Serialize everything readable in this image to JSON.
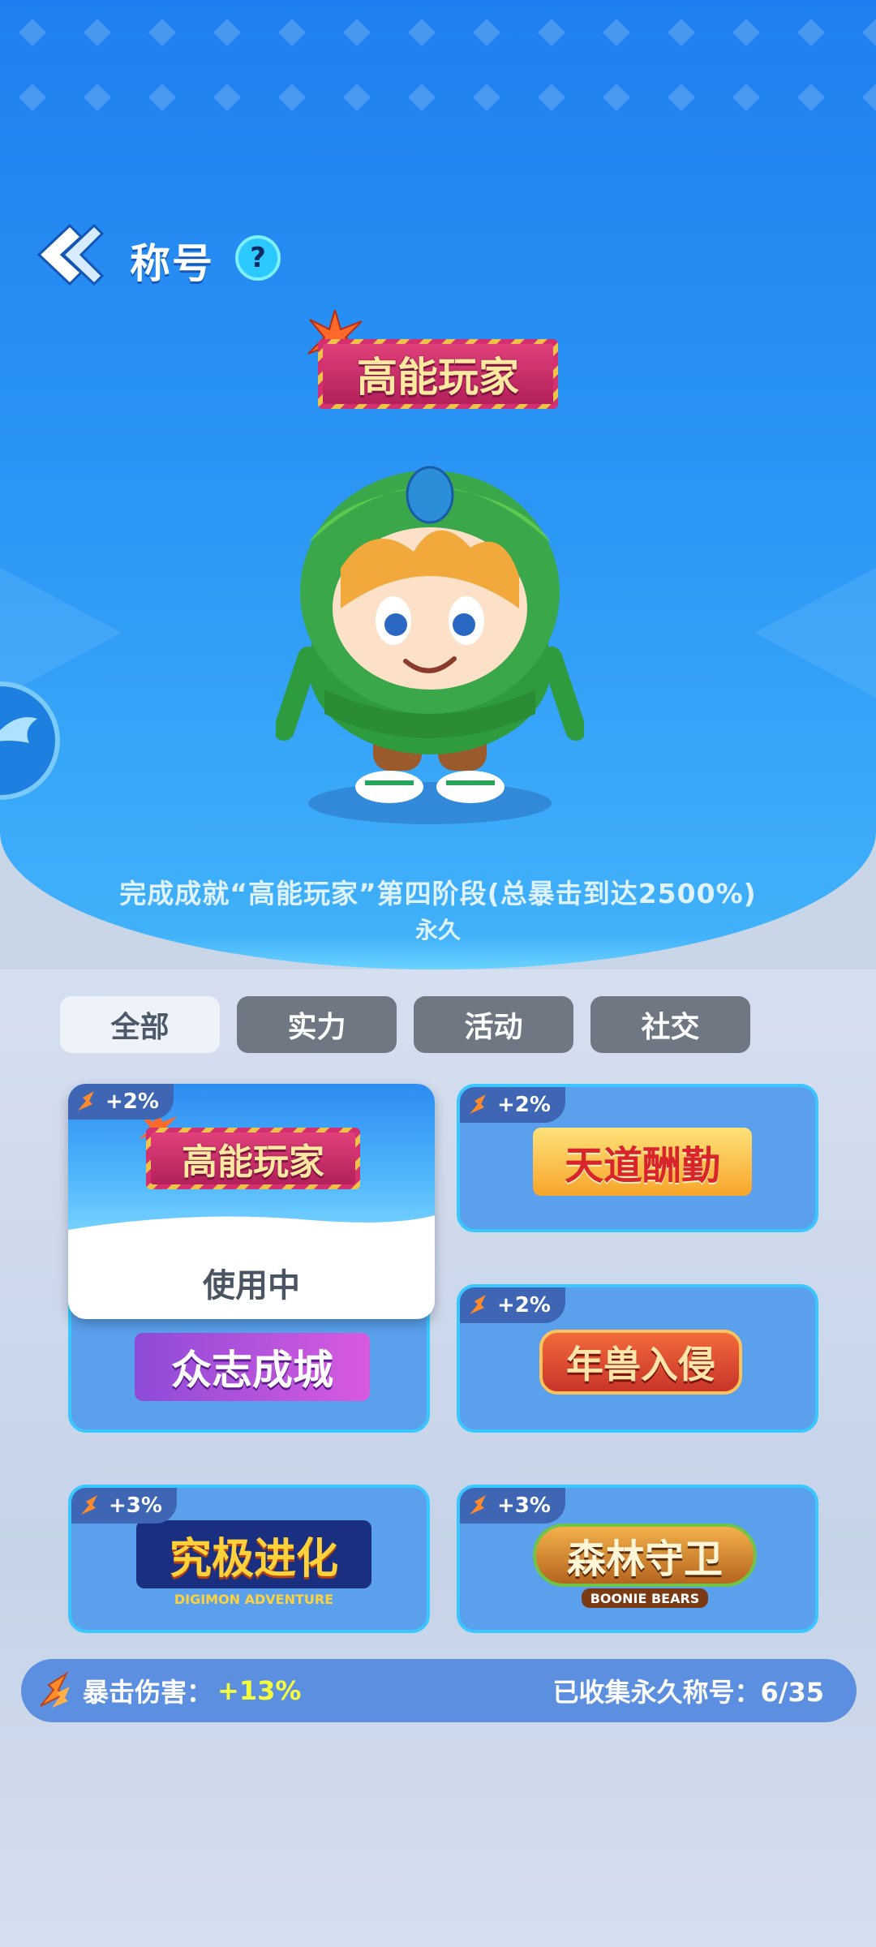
{
  "header": {
    "title": "称号",
    "help_label": "?"
  },
  "current_title": {
    "name": "高能玩家",
    "description": "完成成就“高能玩家”第四阶段(总暴击到达2500%)",
    "duration": "永久"
  },
  "tabs": [
    {
      "label": "全部",
      "active": true
    },
    {
      "label": "实力",
      "active": false
    },
    {
      "label": "活动",
      "active": false
    },
    {
      "label": "社交",
      "active": false
    }
  ],
  "titles": [
    {
      "name": "高能玩家",
      "bonus": "+2%",
      "status": "使用中",
      "selected": true
    },
    {
      "name": "天道酬勤",
      "bonus": "+2%",
      "status": "",
      "selected": false
    },
    {
      "name": "众志成城",
      "bonus": "",
      "status": "",
      "selected": false
    },
    {
      "name": "年兽入侵",
      "bonus": "+2%",
      "status": "",
      "selected": false
    },
    {
      "name": "究极进化",
      "subtitle": "DIGIMON ADVENTURE",
      "bonus": "+3%",
      "status": "",
      "selected": false
    },
    {
      "name": "森林守卫",
      "subtitle": "BOONIE BEARS",
      "bonus": "+3%",
      "status": "",
      "selected": false
    }
  ],
  "footer": {
    "crit_label": "暴击伤害：",
    "crit_value": "+13%",
    "collected": "已收集永久称号：6/35"
  },
  "colors": {
    "hero_blue": "#1f7ff0",
    "card_blue": "#5aa0ec",
    "card_border": "#3ac7ff",
    "stat_yellow": "#f5ff3a",
    "tab_gray": "#6f7782"
  }
}
